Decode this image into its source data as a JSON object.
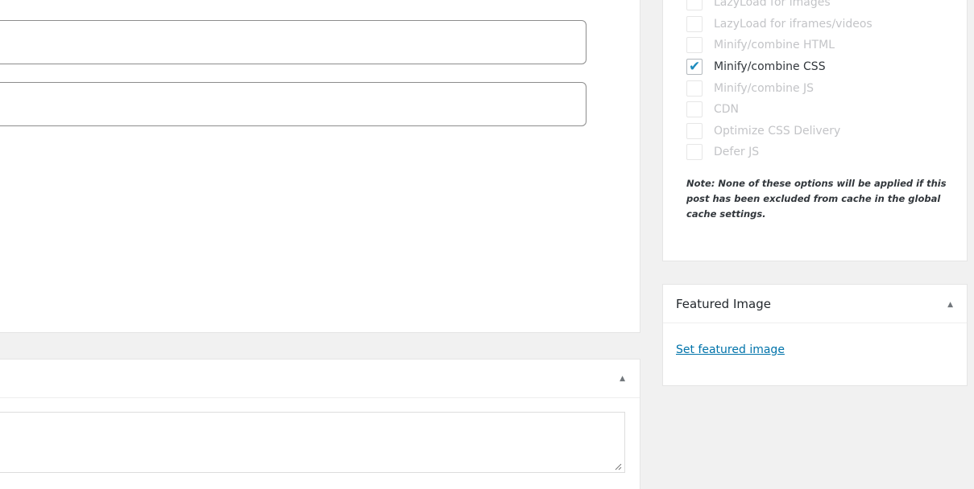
{
  "options": {
    "items": [
      {
        "label": "LazyLoad for images",
        "checked": false
      },
      {
        "label": "LazyLoad for iframes/videos",
        "checked": false
      },
      {
        "label": "Minify/combine HTML",
        "checked": false
      },
      {
        "label": "Minify/combine CSS",
        "checked": true
      },
      {
        "label": "Minify/combine JS",
        "checked": false
      },
      {
        "label": "CDN",
        "checked": false
      },
      {
        "label": "Optimize CSS Delivery",
        "checked": false
      },
      {
        "label": "Defer JS",
        "checked": false
      }
    ],
    "note": "Note: None of these options will be applied if this post has been excluded from cache in the global cache settings."
  },
  "featured_image": {
    "title": "Featured Image",
    "link": "Set featured image",
    "toggle_icon": "triangle-up-icon"
  },
  "lower_box": {
    "toggle_icon": "triangle-up-icon"
  },
  "colors": {
    "accent": "#0073aa",
    "checkmark": "#1e8cbe"
  }
}
